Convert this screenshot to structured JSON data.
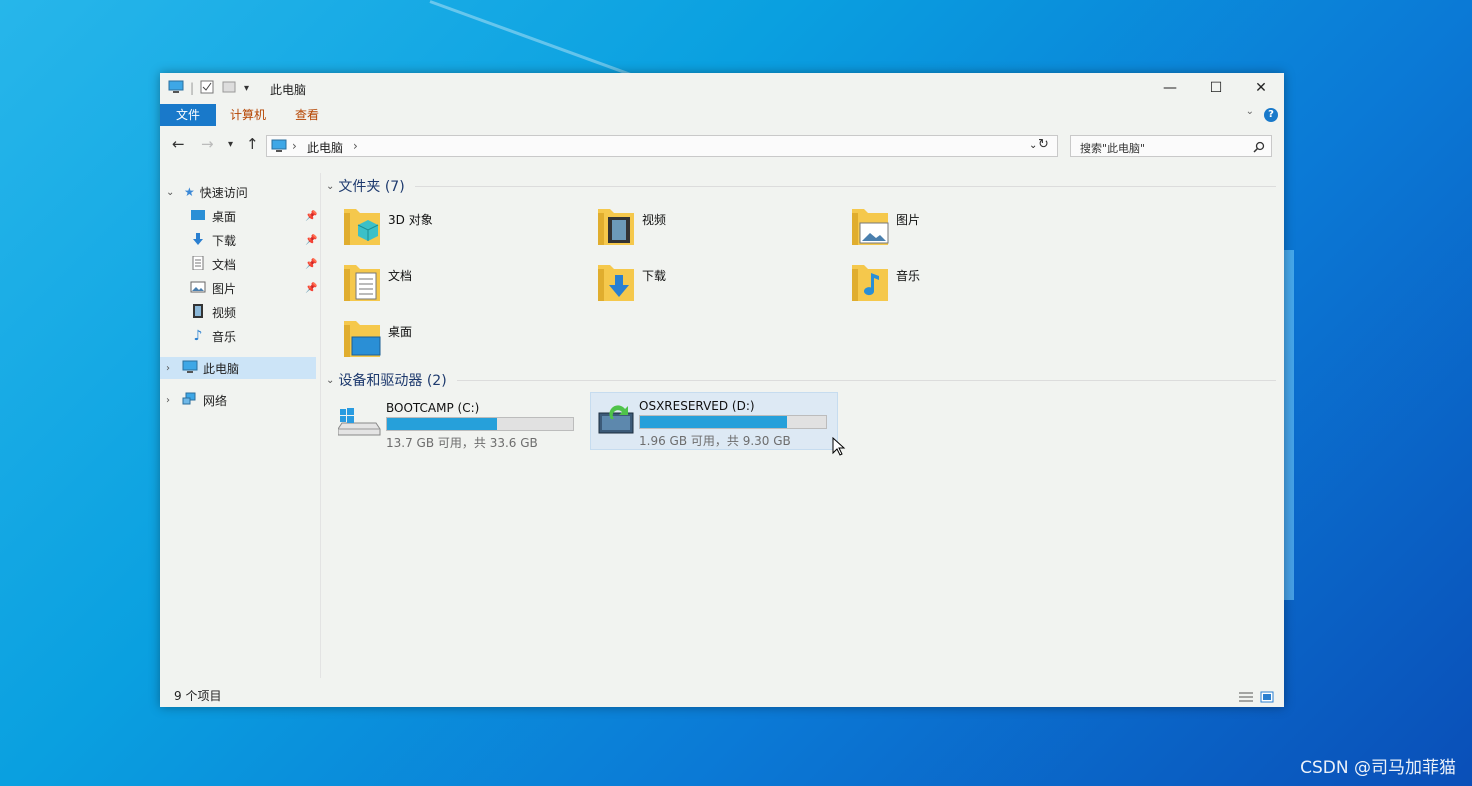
{
  "window": {
    "title": "此电脑",
    "controls": {
      "minimize": "—",
      "maximize": "☐",
      "close": "✕"
    }
  },
  "ribbon": {
    "tabs": [
      "文件",
      "计算机",
      "查看"
    ],
    "help": "?"
  },
  "address": {
    "crumbs": [
      "此电脑"
    ],
    "search_placeholder": "搜索\"此电脑\""
  },
  "sidebar": {
    "quick_access": "快速访问",
    "quick_items": [
      "桌面",
      "下载",
      "文档",
      "图片",
      "视频",
      "音乐"
    ],
    "this_pc": "此电脑",
    "network": "网络"
  },
  "groups": {
    "folders_title": "文件夹 (7)",
    "folders": [
      "3D 对象",
      "视频",
      "图片",
      "文档",
      "下载",
      "音乐",
      "桌面"
    ],
    "devices_title": "设备和驱动器 (2)"
  },
  "drives": [
    {
      "name": "BOOTCAMP (C:)",
      "info": "13.7 GB 可用，共 33.6 GB",
      "used_fraction": 0.59
    },
    {
      "name": "OSXRESERVED (D:)",
      "info": "1.96 GB 可用，共 9.30 GB",
      "used_fraction": 0.79
    }
  ],
  "status": {
    "count": "9 个项目"
  },
  "watermark": "CSDN @司马加菲猫",
  "colors": {
    "accent": "#1979ca",
    "drive_fill": "#26a0da",
    "folder": "#f5c84c"
  }
}
